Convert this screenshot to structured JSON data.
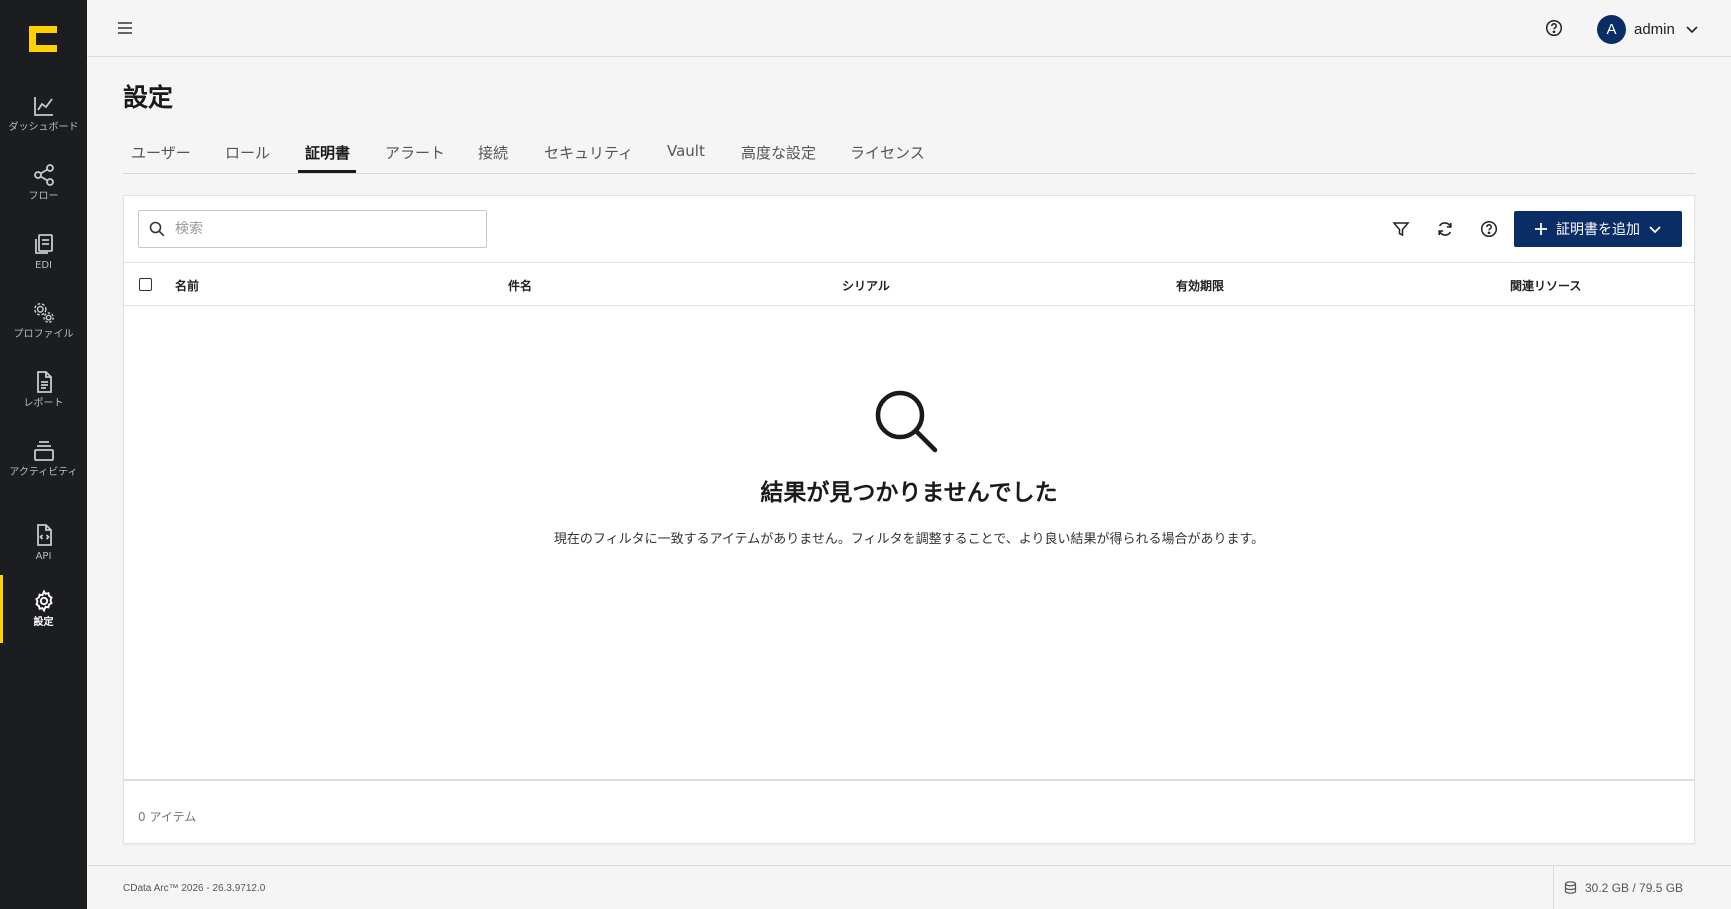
{
  "sidebar": {
    "logo": "cdata-logo",
    "items": [
      {
        "label": "ダッシュボード",
        "icon": "chart-line-icon",
        "active": false
      },
      {
        "label": "フロー",
        "icon": "share-nodes-icon",
        "active": false
      },
      {
        "label": "EDI",
        "icon": "documents-icon",
        "active": false
      },
      {
        "label": "プロファイル",
        "icon": "gears-icon",
        "active": false
      },
      {
        "label": "レポート",
        "icon": "report-icon",
        "active": false
      },
      {
        "label": "アクティビティ",
        "icon": "activity-icon",
        "active": false
      },
      {
        "label": "API",
        "icon": "api-file-icon",
        "active": false
      },
      {
        "label": "設定",
        "icon": "gear-icon",
        "active": true
      }
    ]
  },
  "header": {
    "user_initial": "A",
    "user_name": "admin"
  },
  "page": {
    "title": "設定",
    "tabs": [
      {
        "label": "ユーザー",
        "active": false
      },
      {
        "label": "ロール",
        "active": false
      },
      {
        "label": "証明書",
        "active": true
      },
      {
        "label": "アラート",
        "active": false
      },
      {
        "label": "接続",
        "active": false
      },
      {
        "label": "セキュリティ",
        "active": false
      },
      {
        "label": "Vault",
        "active": false
      },
      {
        "label": "高度な設定",
        "active": false
      },
      {
        "label": "ライセンス",
        "active": false
      }
    ]
  },
  "toolbar": {
    "search_placeholder": "検索",
    "add_label": "証明書を追加"
  },
  "table": {
    "columns": [
      "名前",
      "件名",
      "シリアル",
      "有効期限",
      "関連リソース"
    ],
    "rows": []
  },
  "empty_state": {
    "title": "結果が見つかりませんでした",
    "description": "現在のフィルタに一致するアイテムがありません。フィルタを調整することで、より良い結果が得られる場合があります。"
  },
  "footer": {
    "item_count": "0 アイテム"
  },
  "status": {
    "version": "CData Arc™ 2026 - 26.3.9712.0",
    "storage": "30.2 GB / 79.5 GB"
  },
  "colors": {
    "sidebar_bg": "#1b1d21",
    "accent_yellow": "#ffd000",
    "primary_navy": "#0b2d66"
  }
}
